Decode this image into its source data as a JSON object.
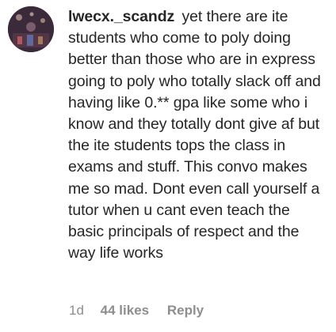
{
  "comment": {
    "username": "lwecx._scandz",
    "text": "yet there are ite students who come to poly doing better than those who are in express going to poly who totally slack off and having like 0.** gpa like some who i know and they totally dont give af but the ite students tops the class in exams and stuff. This convo makes me so mad. Dont even call yourself a tutor when u cant even teach the basic principals of respect and the way life works",
    "time": "1d",
    "likes": "44 likes",
    "reply_label": "Reply",
    "avatar_icon": "profile-photo-avatar"
  },
  "colors": {
    "text": "#262626",
    "meta": "#8e8e8e",
    "background": "#ffffff"
  }
}
